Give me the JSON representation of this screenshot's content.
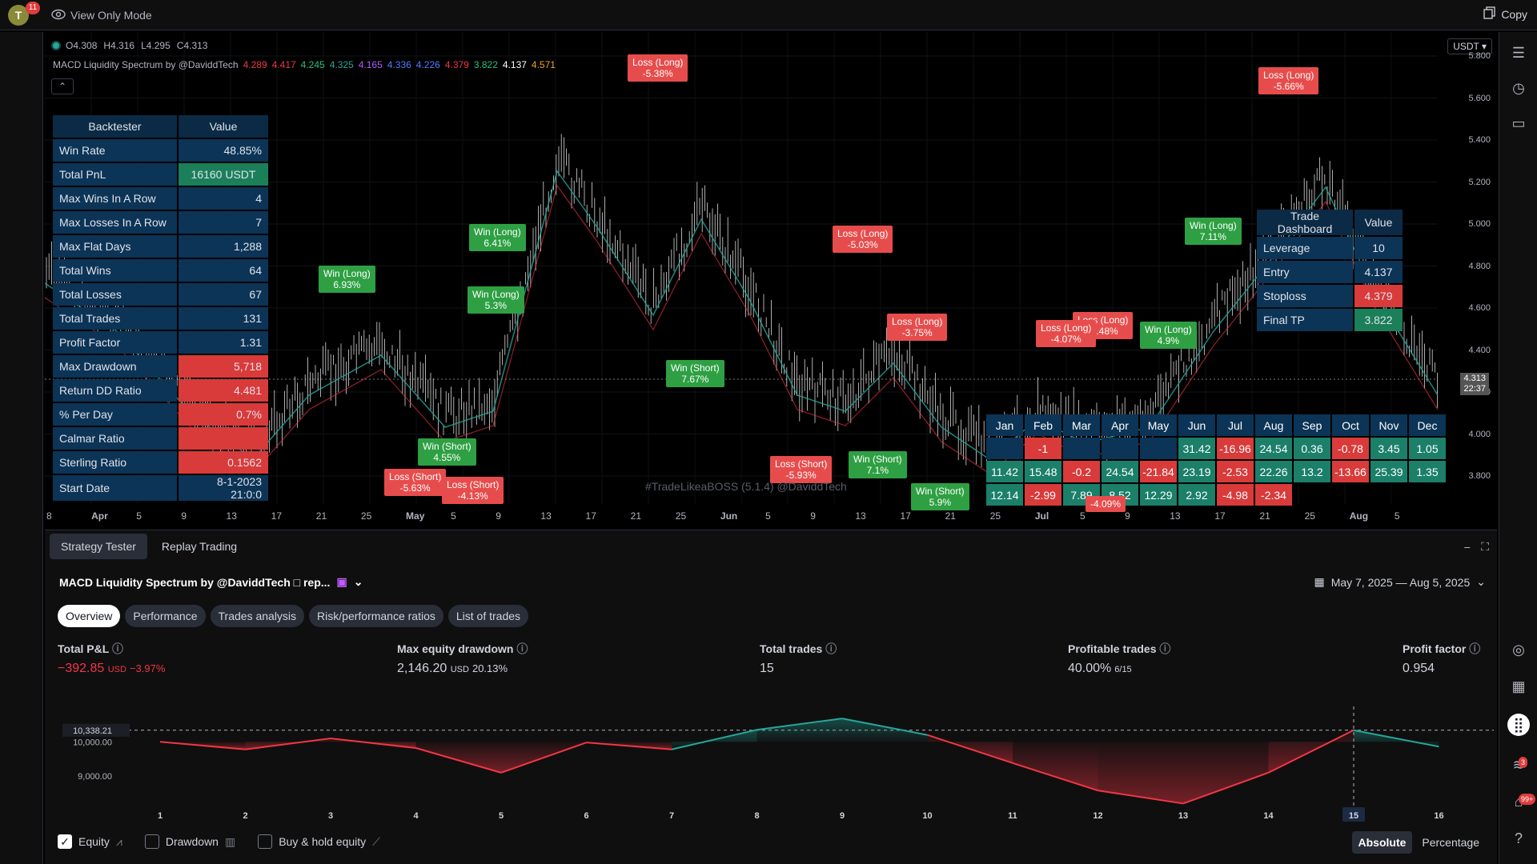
{
  "topbar": {
    "avatar_letter": "T",
    "avatar_badge": "11",
    "view_only": "View Only Mode",
    "copy": "Copy"
  },
  "chart": {
    "ohlc": {
      "o": "O4.308",
      "h": "H4.316",
      "l": "L4.295",
      "c": "C4.313"
    },
    "indicator_title": "MACD Liquidity Spectrum by @DaviddTech",
    "indicator_values": [
      {
        "v": "4.289",
        "color": "#f23645"
      },
      {
        "v": "4.417",
        "color": "#f23645"
      },
      {
        "v": "4.245",
        "color": "#26c281"
      },
      {
        "v": "4.325",
        "color": "#26a69a"
      },
      {
        "v": "4.165",
        "color": "#b05cff"
      },
      {
        "v": "4.336",
        "color": "#4f7cff"
      },
      {
        "v": "4.226",
        "color": "#4f7cff"
      },
      {
        "v": "4.379",
        "color": "#f23645"
      },
      {
        "v": "3.822",
        "color": "#26c281"
      },
      {
        "v": "4.137",
        "color": "#ffffff"
      },
      {
        "v": "4.571",
        "color": "#f0a030"
      }
    ],
    "currency": "USDT",
    "price_axis": [
      "5.800",
      "5.600",
      "5.400",
      "5.200",
      "5.000",
      "4.800",
      "4.600",
      "4.400",
      "4.200",
      "4.000",
      "3.800"
    ],
    "price_now": "4.313",
    "price_now_time": "22:37",
    "time_axis": [
      "8",
      "Apr",
      "5",
      "9",
      "13",
      "17",
      "21",
      "25",
      "May",
      "5",
      "9",
      "13",
      "17",
      "21",
      "25",
      "Jun",
      "5",
      "9",
      "13",
      "17",
      "21",
      "25",
      "Jul",
      "5",
      "9",
      "13",
      "17",
      "21",
      "25",
      "Aug",
      "5"
    ],
    "watermark": "#TradeLikeaBOSS (5.1.4) @DaviddTech",
    "backtester": {
      "headers": [
        "Backtester",
        "Value"
      ],
      "rows": [
        {
          "label": "Win Rate",
          "value": "48.85%",
          "style": "normal"
        },
        {
          "label": "Total PnL",
          "value": "16160 USDT",
          "style": "green"
        },
        {
          "label": "Max Wins In A Row",
          "value": "4",
          "style": "normal"
        },
        {
          "label": "Max Losses In A Row",
          "value": "7",
          "style": "normal"
        },
        {
          "label": "Max Flat Days",
          "value": "1,288",
          "style": "normal"
        },
        {
          "label": "Total Wins",
          "value": "64",
          "style": "normal"
        },
        {
          "label": "Total Losses",
          "value": "67",
          "style": "normal"
        },
        {
          "label": "Total Trades",
          "value": "131",
          "style": "normal"
        },
        {
          "label": "Profit Factor",
          "value": "1.31",
          "style": "normal"
        },
        {
          "label": "Max Drawdown",
          "value": "5,718",
          "style": "red"
        },
        {
          "label": "Return DD Ratio",
          "value": "4.481",
          "style": "red"
        },
        {
          "label": "% Per Day",
          "value": "0.7%",
          "style": "red"
        },
        {
          "label": "Calmar Ratio",
          "value": "",
          "style": "red"
        },
        {
          "label": "Sterling Ratio",
          "value": "0.1562",
          "style": "red"
        },
        {
          "label": "Start Date",
          "value": "8-1-2023 21:0:0",
          "style": "normal"
        }
      ]
    },
    "trade_dashboard": {
      "headers": [
        "Trade Dashboard",
        "Value"
      ],
      "rows": [
        {
          "label": "Leverage",
          "value": "10",
          "style": "normal"
        },
        {
          "label": "Entry",
          "value": "4.137",
          "style": "normal"
        },
        {
          "label": "Stoploss",
          "value": "4.379",
          "style": "red"
        },
        {
          "label": "Final TP",
          "value": "3.822",
          "style": "green"
        }
      ]
    },
    "monthly": {
      "months": [
        "Jan",
        "Feb",
        "Mar",
        "Apr",
        "May",
        "Jun",
        "Jul",
        "Aug",
        "Sep",
        "Oct",
        "Nov",
        "Dec"
      ],
      "row1": [
        "",
        "-1",
        "",
        "",
        "",
        "31.42",
        "-16.96",
        "24.54",
        "0.36",
        "-0.78",
        "3.45",
        "1.05"
      ],
      "row2": [
        "11.42",
        "15.48",
        "-0.2",
        "24.54",
        "-21.84",
        "23.19",
        "-2.53",
        "22.26",
        "13.2",
        "-13.66",
        "25.39",
        "1.35"
      ],
      "row3": [
        "12.14",
        "-2.99",
        "7.89",
        "8.52",
        "12.29",
        "2.92",
        "-4.98",
        "-2.34"
      ]
    },
    "trade_tags": [
      {
        "text": "Loss (Long)\n-5.38%",
        "type": "loss"
      },
      {
        "text": "Loss (Long)\n-5.66%",
        "type": "loss"
      },
      {
        "text": "Win (Long)\n6.93%",
        "type": "win"
      },
      {
        "text": "Win (Long)\n6.41%",
        "type": "win"
      },
      {
        "text": "Win (Long)\n5.3%",
        "type": "win"
      },
      {
        "text": "Loss (Long)\n-5.03%",
        "type": "loss"
      },
      {
        "text": "Win (Long)\n7.11%",
        "type": "win"
      },
      {
        "text": "Loss (Long)\n-3.75%",
        "type": "loss"
      },
      {
        "text": "Loss (Long)\n-4.48%",
        "type": "loss"
      },
      {
        "text": "Loss (Long)\n-4.07%",
        "type": "loss"
      },
      {
        "text": "Win (Long)\n4.9%",
        "type": "win"
      },
      {
        "text": "Win (Short)\n7.67%",
        "type": "win"
      },
      {
        "text": "Win (Short)\n4.55%",
        "type": "win"
      },
      {
        "text": "Loss (Short)\n-5.63%",
        "type": "loss"
      },
      {
        "text": "Loss (Short)\n-4.13%",
        "type": "loss"
      },
      {
        "text": "Loss (Short)\n-5.93%",
        "type": "loss"
      },
      {
        "text": "Win (Short)\n7.1%",
        "type": "win"
      },
      {
        "text": "Win (Short)\n5.9%",
        "type": "win"
      },
      {
        "text": "-4.09%",
        "type": "loss"
      }
    ]
  },
  "right_toolbar": {
    "icons": [
      "watchlist-icon",
      "alerts-clock-icon",
      "chat-icon",
      "target-icon",
      "calendar-icon",
      "apps-grid-icon",
      "feed-icon",
      "notifications-icon",
      "help-icon"
    ],
    "feed_badge": "3",
    "notif_badge": "99+"
  },
  "bottom": {
    "tabs": [
      "Strategy Tester",
      "Replay Trading"
    ],
    "strategy_title": "MACD Liquidity Spectrum by @DaviddTech □ rep...",
    "date_range": "May 7, 2025 — Aug 5, 2025",
    "sub_tabs": [
      "Overview",
      "Performance",
      "Trades analysis",
      "Risk/performance ratios",
      "List of trades"
    ],
    "metrics": {
      "total_pl_label": "Total P&L",
      "total_pl_value": "−392.85",
      "total_pl_unit": "USD",
      "total_pl_pct": "−3.97%",
      "max_dd_label": "Max equity drawdown",
      "max_dd_value": "2,146.20",
      "max_dd_unit": "USD",
      "max_dd_pct": "20.13%",
      "total_trades_label": "Total trades",
      "total_trades_value": "15",
      "profitable_label": "Profitable trades",
      "profitable_value": "40.00%",
      "profitable_sub": "6/15",
      "profit_factor_label": "Profit factor",
      "profit_factor_value": "0.954"
    },
    "legend": {
      "equity": "Equity",
      "drawdown": "Drawdown",
      "buy_hold": "Buy & hold equity"
    },
    "modes": [
      "Absolute",
      "Percentage"
    ]
  },
  "chart_data": {
    "type": "line",
    "x": [
      1,
      2,
      3,
      4,
      5,
      6,
      7,
      8,
      9,
      10,
      11,
      12,
      13,
      14,
      15,
      16
    ],
    "series": [
      {
        "name": "Equity",
        "values": [
          10000,
          9780,
          10100,
          9820,
          9100,
          9980,
          9780,
          10350,
          10680,
          10200,
          9380,
          8580,
          8200,
          9100,
          10338.21,
          9860
        ]
      }
    ],
    "y_ticks": [
      "10,000.00",
      "9,000.00"
    ],
    "y_marker": "10,338.21",
    "highlight_x": 15,
    "baseline": 10000,
    "colors": {
      "above": "#26a69a",
      "below": "#f23645"
    }
  }
}
